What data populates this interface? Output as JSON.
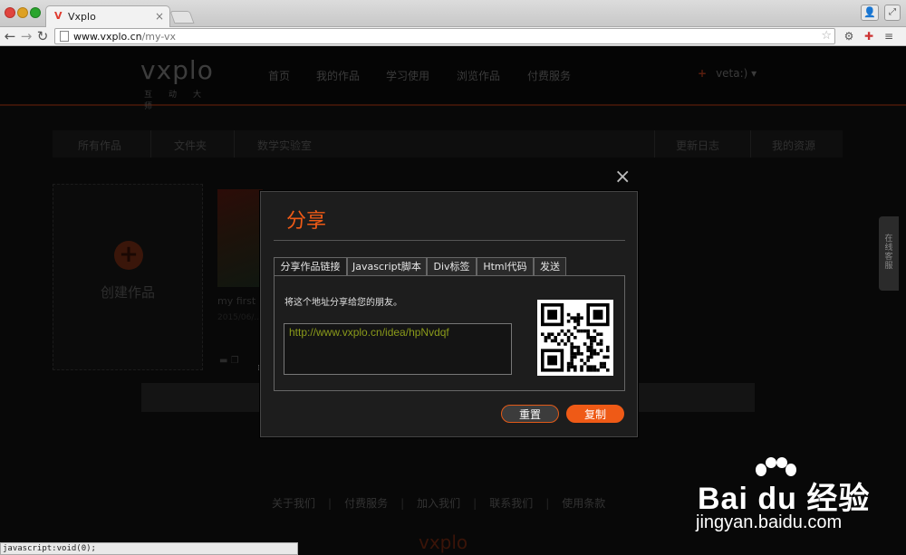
{
  "browser": {
    "tab_title": "Vxplo",
    "tab_favicon": "V",
    "url_host": "www.vxplo.cn",
    "url_path": "/my-vx",
    "status_text": "javascript:void(0);"
  },
  "site": {
    "logo": "vxplo",
    "logo_sub": "互动大师",
    "nav": [
      "首页",
      "我的作品",
      "学习使用",
      "浏览作品",
      "付费服务"
    ],
    "user": "veta:)",
    "subnav": [
      "所有作品",
      "文件夹",
      "数学实验室",
      "更新日志",
      "我的资源"
    ],
    "create_label": "创建作品",
    "work_title": "my first p",
    "work_meta": "2015/06/...",
    "footer_links": [
      "关于我们",
      "付费服务",
      "加入我们",
      "联系我们",
      "使用条款"
    ],
    "footer_logo": "vxplo",
    "side_widget": "在线客服"
  },
  "modal": {
    "title": "分享",
    "tabs": [
      "分享作品链接",
      "Javascript脚本",
      "Div标签",
      "Html代码",
      "发送"
    ],
    "hint": "将这个地址分享给您的朋友。",
    "link": "http://www.vxplo.cn/idea/hpNvdqf",
    "reset_label": "重置",
    "copy_label": "复制",
    "close_glyph": "×"
  },
  "watermark": {
    "text": "Bai du 经验",
    "url": "jingyan.baidu.com"
  },
  "colors": {
    "accent": "#ef5a16",
    "link_text": "#8a9a1a"
  }
}
